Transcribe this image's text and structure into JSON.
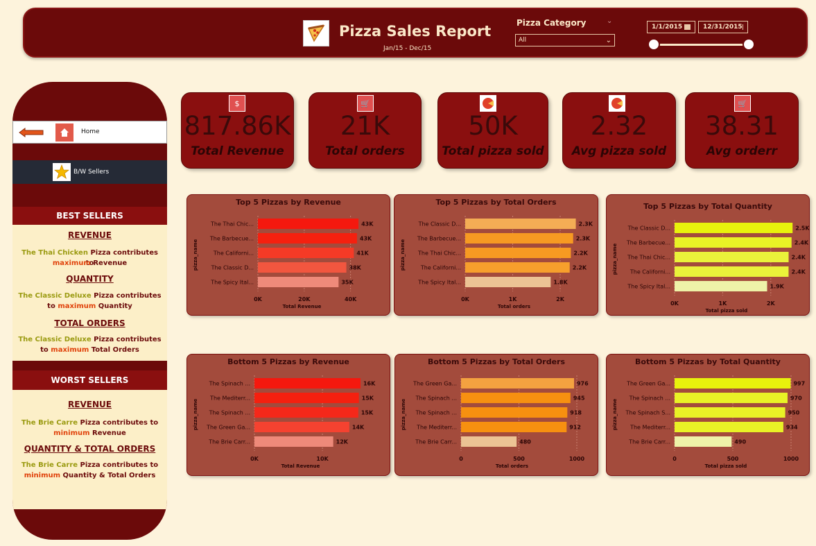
{
  "header": {
    "title": "Pizza Sales Report",
    "subtitle": "Jan/15 - Dec/15",
    "category_label": "Pizza Category",
    "category_value": "All",
    "date_start": "1/1/2015",
    "date_end": "12/31/2015"
  },
  "sidebar": {
    "home_label": "Home",
    "bw_label": "B/W Sellers",
    "best_title": "BEST SELLERS",
    "worst_title": "WORST SELLERS",
    "best": {
      "revenue_title": "REVENUE",
      "revenue_l1_name": "The Thai Chicken",
      "revenue_l1_rest": " Pizza contributes to",
      "revenue_l2_key": "maximum",
      "revenue_l2_rest": " Revenue",
      "quantity_title": "QUANTITY",
      "quantity_l1_name": "The Classic Deluxe",
      "quantity_l1_rest": " Pizza contributes",
      "quantity_l2_pre": "to ",
      "quantity_l2_key": "maximum",
      "quantity_l2_rest": " Quantity",
      "orders_title": "TOTAL ORDERS",
      "orders_l1_name": "The Classic Deluxe",
      "orders_l1_rest": " Pizza contributes",
      "orders_l2_pre": "to ",
      "orders_l2_key": "maximum",
      "orders_l2_rest": " Total Orders"
    },
    "worst": {
      "revenue_title": "REVENUE",
      "revenue_l1_name": "The Brie Carre",
      "revenue_l1_rest": " Pizza contributes to",
      "revenue_l2_key": "minimum",
      "revenue_l2_rest": " Revenue",
      "qo_title": "QUANTITY & TOTAL ORDERS",
      "qo_l1_name": "The Brie Carre",
      "qo_l1_rest": " Pizza contributes to",
      "qo_l2_key": "minimum",
      "qo_l2_rest": " Quantity & Total Orders"
    }
  },
  "kpis": [
    {
      "value": "817.86K",
      "label": "Total Revenue",
      "icon": "money-bag-icon"
    },
    {
      "value": "21K",
      "label": "Total orders",
      "icon": "shopping-cart-icon"
    },
    {
      "value": "50K",
      "label": "Total pizza sold",
      "icon": "pizza-icon"
    },
    {
      "value": "2.32",
      "label": "Avg pizza sold",
      "icon": "pizza-icon"
    },
    {
      "value": "38.31",
      "label": "Avg orderr",
      "icon": "shopping-cart-icon"
    }
  ],
  "colors": {
    "red_bar": "#f5180e",
    "orange_bar": "#f78f0a",
    "yellow_bar": "#e8f20c",
    "panel_bg": "#a34b3c",
    "header_bg": "#6b0a0a"
  },
  "chart_data": [
    {
      "type": "bar",
      "orientation": "horizontal",
      "title": "Top 5 Pizzas by Revenue",
      "categories": [
        "The Thai Chic...",
        "The Barbecue...",
        "The Californi...",
        "The Classic D...",
        "The Spicy Ital..."
      ],
      "values": [
        43434,
        42768,
        41410,
        38180,
        34831
      ],
      "labels": [
        "43K",
        "43K",
        "41K",
        "38K",
        "35K"
      ],
      "bar_colors": [
        "#f5180e",
        "#f5200f",
        "#f53a26",
        "#f2563f",
        "#ee8a7a"
      ],
      "xlabel": "Total Revenue",
      "ylabel": "pizza_name",
      "ticks": [
        0,
        20000,
        40000
      ],
      "tick_labels": [
        "0K",
        "20K",
        "40K"
      ],
      "xmax": 44000
    },
    {
      "type": "bar",
      "orientation": "horizontal",
      "title": "Top 5 Pizzas by Total Orders",
      "categories": [
        "The Classic D...",
        "The Barbecue...",
        "The Thai Chic...",
        "The Californi...",
        "The Spicy Ital..."
      ],
      "values": [
        2329,
        2273,
        2225,
        2200,
        1800
      ],
      "labels": [
        "2.3K",
        "2.3K",
        "2.2K",
        "2.2K",
        "1.8K"
      ],
      "bar_colors": [
        "#f4ad55",
        "#f79a22",
        "#f79a22",
        "#f79f2c",
        "#ecc394"
      ],
      "xlabel": "Total orders",
      "ylabel": "pizza_name",
      "ticks": [
        0,
        1000,
        2000
      ],
      "tick_labels": [
        "0K",
        "1K",
        "2K"
      ],
      "xmax": 2350
    },
    {
      "type": "bar",
      "orientation": "horizontal",
      "title": "Top 5 Pizzas by Total Quantity",
      "categories": [
        "The Classic D...",
        "The Barbecue...",
        "The Thai Chic...",
        "The Californi...",
        "The Spicy Ital..."
      ],
      "values": [
        2453,
        2432,
        2371,
        2370,
        1924
      ],
      "labels": [
        "2.5K",
        "2.4K",
        "2.4K",
        "2.4K",
        "1.9K"
      ],
      "bar_colors": [
        "#e8f20c",
        "#e9f226",
        "#eaf23a",
        "#eaf23a",
        "#eef2a8"
      ],
      "xlabel": "Total pizza sold",
      "ylabel": "pizza_name",
      "ticks": [
        0,
        1000,
        2000
      ],
      "tick_labels": [
        "0K",
        "1K",
        "2K"
      ],
      "xmax": 2450
    },
    {
      "type": "bar",
      "orientation": "horizontal",
      "title": "Bottom 5 Pizzas by Revenue",
      "categories": [
        "The Spinach ...",
        "The Mediterr...",
        "The Spinach ...",
        "The Green Ga...",
        "The Brie Carr..."
      ],
      "values": [
        15596,
        15360,
        15277,
        13956,
        11588
      ],
      "labels": [
        "16K",
        "15K",
        "15K",
        "14K",
        "12K"
      ],
      "bar_colors": [
        "#f5180e",
        "#f5200f",
        "#f5281a",
        "#f54230",
        "#ee8a7a"
      ],
      "xlabel": "Total Revenue",
      "ylabel": "pizza_name",
      "ticks": [
        0,
        10000
      ],
      "tick_labels": [
        "0K",
        "10K"
      ],
      "xmax": 15600
    },
    {
      "type": "bar",
      "orientation": "horizontal",
      "title": "Bottom 5 Pizzas by Total Orders",
      "categories": [
        "The Green Ga...",
        "The Spinach ...",
        "The Spinach ...",
        "The Mediterr...",
        "The Brie Carr..."
      ],
      "values": [
        976,
        945,
        918,
        912,
        480
      ],
      "labels": [
        "976",
        "945",
        "918",
        "912",
        "480"
      ],
      "bar_colors": [
        "#f4a240",
        "#f79010",
        "#f79010",
        "#f79010",
        "#ecc394"
      ],
      "xlabel": "Total orders",
      "ylabel": "pizza_name",
      "ticks": [
        0,
        500,
        1000
      ],
      "tick_labels": [
        "0",
        "500",
        "1000"
      ],
      "xmax": 1000
    },
    {
      "type": "bar",
      "orientation": "horizontal",
      "title": "Bottom 5 Pizzas by Total Quantity",
      "categories": [
        "The Green Ga...",
        "The Spinach ...",
        "The Spinach S...",
        "The Mediterr...",
        "The Brie Carr..."
      ],
      "values": [
        997,
        970,
        950,
        934,
        490
      ],
      "labels": [
        "997",
        "970",
        "950",
        "934",
        "490"
      ],
      "bar_colors": [
        "#e8f20c",
        "#e9f226",
        "#e9f226",
        "#e9f226",
        "#eef2a8"
      ],
      "xlabel": "Total pizza sold",
      "ylabel": "pizza_name",
      "ticks": [
        0,
        500,
        1000
      ],
      "tick_labels": [
        "0",
        "500",
        "1000"
      ],
      "xmax": 1000
    }
  ]
}
